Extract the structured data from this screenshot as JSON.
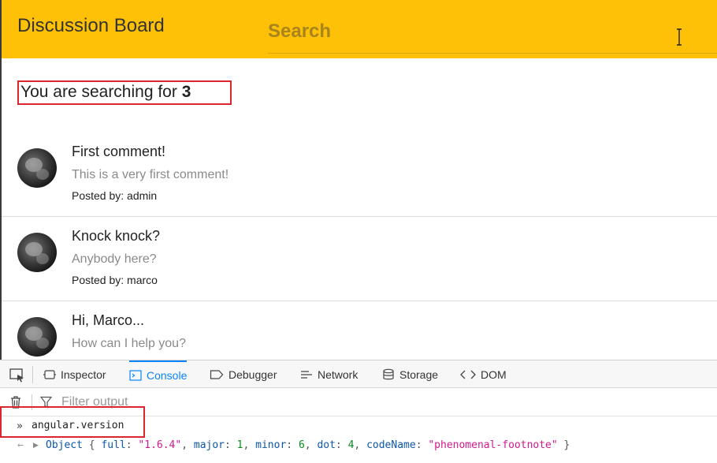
{
  "app": {
    "title": "Discussion Board",
    "search_placeholder": "Search",
    "search_message_prefix": "You are searching for ",
    "search_term": "3",
    "comments": [
      {
        "title": "First comment!",
        "body": "This is a very first comment!",
        "posted_by_label": "Posted by: ",
        "author": "admin"
      },
      {
        "title": "Knock knock?",
        "body": "Anybody here?",
        "posted_by_label": "Posted by: ",
        "author": "marco"
      },
      {
        "title": "Hi, Marco...",
        "body": "How can I help you?"
      }
    ]
  },
  "devtools": {
    "tabs": [
      "Inspector",
      "Console",
      "Debugger",
      "Network",
      "Storage",
      "DOM"
    ],
    "active_tab": "Console",
    "filter_placeholder": "Filter output",
    "command": "angular.version",
    "result": {
      "type_label": "Object",
      "full_key": "full",
      "full_value": "\"1.6.4\"",
      "major_key": "major",
      "major_value": "1",
      "minor_key": "minor",
      "minor_value": "6",
      "dot_key": "dot",
      "dot_value": "4",
      "codename_key": "codeName",
      "codename_value": "\"phenomenal-footnote\""
    }
  },
  "colors": {
    "header": "#ffc107",
    "highlight_box": "#d9262f",
    "devtools_accent": "#0a84ff"
  }
}
